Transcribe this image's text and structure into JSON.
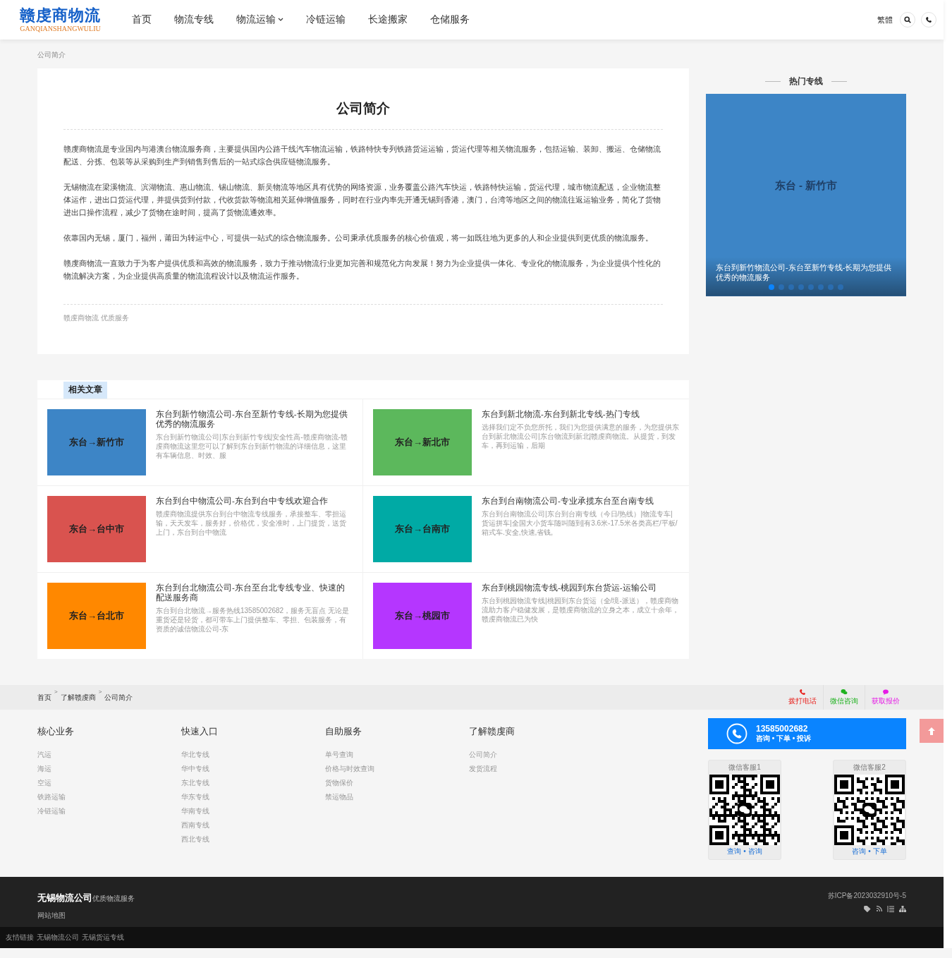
{
  "header": {
    "logo": {
      "title": "赣虔商物流",
      "subtitle": "GANQIANSHANGWULIU"
    },
    "nav": [
      {
        "label": "首页",
        "has_dropdown": false
      },
      {
        "label": "物流专线",
        "has_dropdown": false
      },
      {
        "label": "物流运输",
        "has_dropdown": true
      },
      {
        "label": "冷链运输",
        "has_dropdown": false
      },
      {
        "label": "长途搬家",
        "has_dropdown": false
      },
      {
        "label": "仓储服务",
        "has_dropdown": false
      }
    ],
    "language_toggle": "繁體"
  },
  "breadcrumb": "公司简介",
  "article": {
    "title": "公司简介",
    "paragraphs": [
      "赣虔商物流是专业国内与港澳台物流服务商，主要提供国内公路干线汽车物流运输，铁路特快专列铁路货运运输，货运代理等相关物流服务，包括运输、装卸、搬运、仓储物流配送、分拣、包装等从采购到生产到销售到售后的一站式综合供应链物流服务。",
      "无锡物流在梁溪物流、滨湖物流、惠山物流、锡山物流、新吴物流等地区具有优势的网络资源，业务覆盖公路汽车快运，铁路特快运输，货运代理，城市物流配送，企业物流整体运作，进出口货运代理，并提供货到付款，代收货款等物流相关延伸增值服务，同时在行业内率先开通无锡到香港，澳门，台湾等地区之间的物流往返运输业务，简化了货物进出口操作流程，减少了货物在途时间，提高了货物流通效率。",
      "依靠国内无锡，厦门，福州，莆田为转运中心，可提供一站式的综合物流服务。公司秉承优质服务的核心价值观，将一如既往地为更多的人和企业提供到更优质的物流服务。",
      "赣虔商物流一直致力于为客户提供优质和高效的物流服务，致力于推动物流行业更加完善和规范化方向发展！努力为企业提供一体化、专业化的物流服务，为企业提供个性化的物流解决方案，为企业提供高质量的物流流程设计以及物流运作服务。"
    ],
    "tags": "赣虔商物流 优质服务"
  },
  "hot_routes": {
    "title": "热门专线",
    "slide_title": "东台 - 新竹市",
    "slide_caption": "东台到新竹物流公司-东台至新竹专线-长期为您提供优秀的物流服务",
    "dots": [
      {
        "selected": true
      },
      {
        "selected": false
      },
      {
        "selected": false
      },
      {
        "selected": false
      },
      {
        "selected": false
      },
      {
        "selected": false
      },
      {
        "selected": false
      },
      {
        "selected": false
      }
    ]
  },
  "related": {
    "title": "相关文章",
    "items": [
      {
        "thumb": "东台→新竹市",
        "color": "#3d85c6",
        "title": "东台到新竹物流公司-东台至新竹专线-长期为您提供优秀的物流服务",
        "excerpt": "东台到新竹物流公司|东台到新竹专线|安全性高-赣虔商物流-赣虔商物流这里您可以了解到东台到新竹物流的详细信息，这里有车辆信息、时效、服"
      },
      {
        "thumb": "东台→新北市",
        "color": "#5cb85c",
        "title": "东台到新北物流-东台到新北专线-热门专线",
        "excerpt": "选择我们定不负您所托，我们为您提供满意的服务，为您提供东台到新北物流公司|东台物流到新北|赣虔商物流。从提货，到发车，再到运输，后期"
      },
      {
        "thumb": "东台→台中市",
        "color": "#d9534f",
        "title": "东台到台中物流公司-东台到台中专线欢迎合作",
        "excerpt": "赣虔商物流提供东台到台中物流专线服务，承接整车、零担运输，天天发车，服务好，价格优，安全准时，上门提货，送货上门，东台到台中物流"
      },
      {
        "thumb": "东台→台南市",
        "color": "#00aaa5",
        "title": "东台到台南物流公司-专业承揽东台至台南专线",
        "excerpt": "东台到台南物流公司|东台到台南专线（今日/热线）|物流专车|货运拼车|全国大小货车随叫随到|有3.6米-17.5米各类高栏/平板/箱式车.安全,快速,省钱,"
      },
      {
        "thumb": "东台→台北市",
        "color": "#ff8800",
        "title": "东台到台北物流公司-东台至台北专线专业、快速的配送服务商",
        "excerpt": "东台到台北物流→服务热线13585002682，服务无盲点 无论是重货还是轻货，都可带车上门提供整车、零担、包装服务，有资质的诚信物流公司-东"
      },
      {
        "thumb": "东台→桃园市",
        "color": "#b536ff",
        "title": "东台到桃园物流专线-桃园到东台货运-运输公司",
        "excerpt": "东台到桃园物流专线|桃园到东台货运（全/境-派送），赣虔商物流助力客户稳健发展，是赣虔商物流的立身之本，成立十余年，赣虔商物流已为快"
      }
    ]
  },
  "footer_breadcrumb": [
    {
      "kind": "link",
      "label": "首页"
    },
    {
      "kind": "sep",
      "label": ">"
    },
    {
      "kind": "link",
      "label": "了解赣虔商"
    },
    {
      "kind": "sep",
      "label": ">"
    },
    {
      "kind": "link",
      "label": "公司简介"
    }
  ],
  "contact_shortcuts": [
    {
      "kind": "phone",
      "label": "拨打电话",
      "color": "#e8211c"
    },
    {
      "kind": "wechat",
      "label": "微信咨询",
      "color": "#1fb21f"
    },
    {
      "kind": "chat",
      "label": "获取报价",
      "color": "#e61ae6"
    }
  ],
  "footer_columns": [
    {
      "title": "核心业务",
      "links": [
        "汽运",
        "海运",
        "空运",
        "铁路运输",
        "冷链运输"
      ]
    },
    {
      "title": "快速入口",
      "links": [
        "华北专线",
        "华中专线",
        "东北专线",
        "华东专线",
        "华南专线",
        "西南专线",
        "西北专线"
      ]
    },
    {
      "title": "自助服务",
      "links": [
        "单号查询",
        "价格与时效查询",
        "货物保价",
        "禁运物品"
      ]
    },
    {
      "title": "了解赣虔商",
      "links": [
        "公司简介",
        "发货流程"
      ]
    }
  ],
  "hotline": {
    "number": "13585002682",
    "note": "咨询 • 下单 • 投诉"
  },
  "wechat_cards": [
    {
      "title": "微信客服1",
      "caption": "查询 • 咨询"
    },
    {
      "title": "微信客服2",
      "caption": "咨询 • 下单"
    }
  ],
  "footer_bar": {
    "company": "无锡物流公司",
    "slogan": "优质物流服务",
    "sitemap": "网站地图",
    "icp": "苏ICP备2023032910号-5"
  },
  "friend_links": {
    "label": "友情链接",
    "links": [
      "无锡物流公司",
      "无锡货运专线"
    ]
  }
}
